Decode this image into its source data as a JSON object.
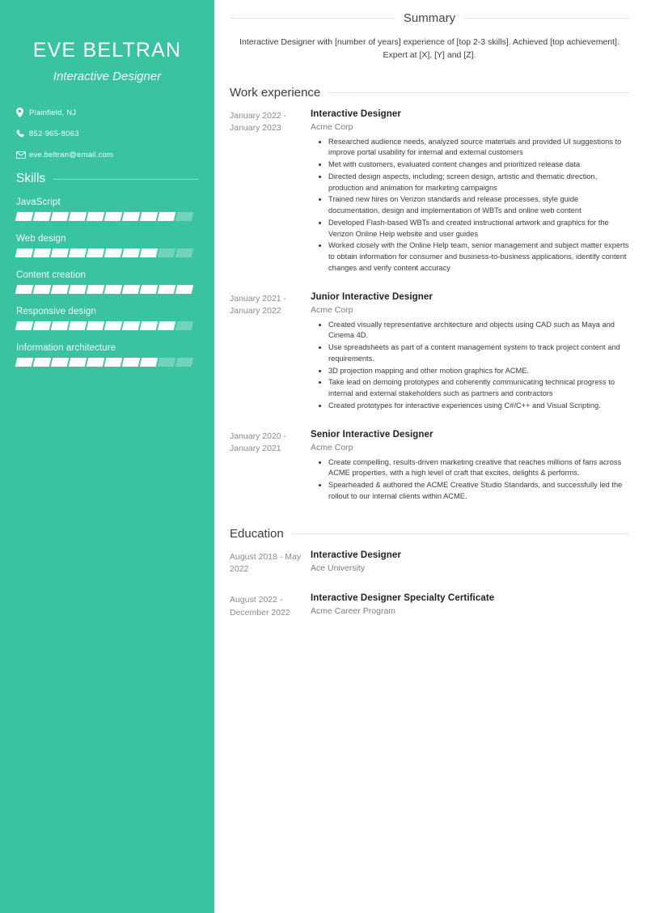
{
  "sidebar": {
    "name": "EVE BELTRAN",
    "role": "Interactive Designer",
    "accent_color": "#3ac3a0",
    "contact": [
      {
        "icon": "location-pin-icon",
        "value": "Plainfield, NJ"
      },
      {
        "icon": "phone-icon",
        "value": "852-965-8063"
      },
      {
        "icon": "envelope-icon",
        "value": "eve.beltran@email.com"
      }
    ],
    "skills_heading": "Skills",
    "skill_total_segments": 10,
    "skills": [
      {
        "name": "JavaScript",
        "filled": 9
      },
      {
        "name": "Web design",
        "filled": 8
      },
      {
        "name": "Content creation",
        "filled": 10
      },
      {
        "name": "Responsive design",
        "filled": 9
      },
      {
        "name": "Information architecture",
        "filled": 8
      }
    ]
  },
  "main": {
    "summary": {
      "heading": "Summary",
      "text": "Interactive Designer with [number of years] experience of [top 2-3 skills]. Achieved [top achievement]. Expert at [X], [Y] and [Z]."
    },
    "work": {
      "heading": "Work experience",
      "entries": [
        {
          "dates": "January 2022 - January 2023",
          "title": "Interactive Designer",
          "org": "Acme Corp",
          "bullets": [
            "Researched audience needs, analyzed source materials and provided UI suggestions to improve portal usability for internal and external customers",
            "Met with customers, evaluated content changes and prioritized release data",
            "Directed design aspects, including; screen design, artistic and thematic direction, production and animation for marketing campaigns",
            "Trained new hires on Verizon standards and release processes, style guide documentation, design and implementation of WBTs and online web content",
            "Developed Flash-based WBTs and created instructional artwork and graphics for the Verizon Online Help website and user guides",
            "Worked closely with the Online Help team, senior management and subject matter experts to obtain information for consumer and business-to-business applications, identify content changes and verify content accuracy"
          ]
        },
        {
          "dates": "January 2021 - January 2022",
          "title": "Junior Interactive Designer",
          "org": "Acme Corp",
          "bullets": [
            "Created visually representative architecture and objects using CAD such as Maya and Cinema 4D.",
            "Use spreadsheets as part of a content management system to track project content and requirements.",
            "3D projection mapping and other motion graphics for ACME.",
            "Take lead on demoing prototypes and coherently communicating technical progress to internal and external stakeholders such as partners and contractors",
            "Created prototypes for interactive experiences using C#/C++ and Visual Scripting."
          ]
        },
        {
          "dates": "January 2020 - January 2021",
          "title": "Senior Interactive Designer",
          "org": "Acme Corp",
          "bullets": [
            "Create compelling, results-driven marketing creative that reaches millions of fans across ACME properties, with a high level of craft that excites, delights & performs.",
            "Spearheaded & authored the ACME Creative Studio Standards, and successfully led the rollout to our internal clients within ACME."
          ]
        }
      ]
    },
    "education": {
      "heading": "Education",
      "entries": [
        {
          "dates": "August 2018 - May 2022",
          "title": "Interactive Designer",
          "org": "Ace University"
        },
        {
          "dates": "August 2022 - December 2022",
          "title": "Interactive Designer Specialty Certificate",
          "org": "Acme Career Program"
        }
      ]
    }
  }
}
